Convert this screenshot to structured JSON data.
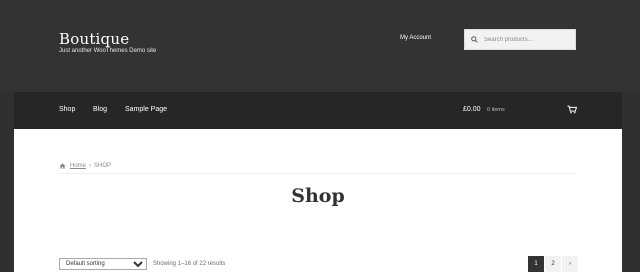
{
  "site": {
    "title": "Boutique",
    "tagline": "Just another WooThemes Demo site"
  },
  "header": {
    "my_account": "My Account",
    "search_placeholder": "Search products…"
  },
  "nav": {
    "items": [
      {
        "label": "Shop"
      },
      {
        "label": "Blog"
      },
      {
        "label": "Sample Page"
      }
    ],
    "cart_amount": "£0.00",
    "cart_count": "0 items"
  },
  "breadcrumb": {
    "home": "Home",
    "separator": "›",
    "current": "SHOP"
  },
  "page": {
    "title": "Shop"
  },
  "shop": {
    "sort_options": [
      "Default sorting"
    ],
    "result_count": "Showing 1–16 of 22 results",
    "pagination": {
      "current": "1",
      "next_page": "2",
      "next_arrow": "›"
    }
  },
  "colors": {
    "header_bg": "#333333",
    "nav_bg": "#262626",
    "content_bg": "#ffffff"
  },
  "icons": [
    "search-icon",
    "cart-icon",
    "home-icon"
  ]
}
